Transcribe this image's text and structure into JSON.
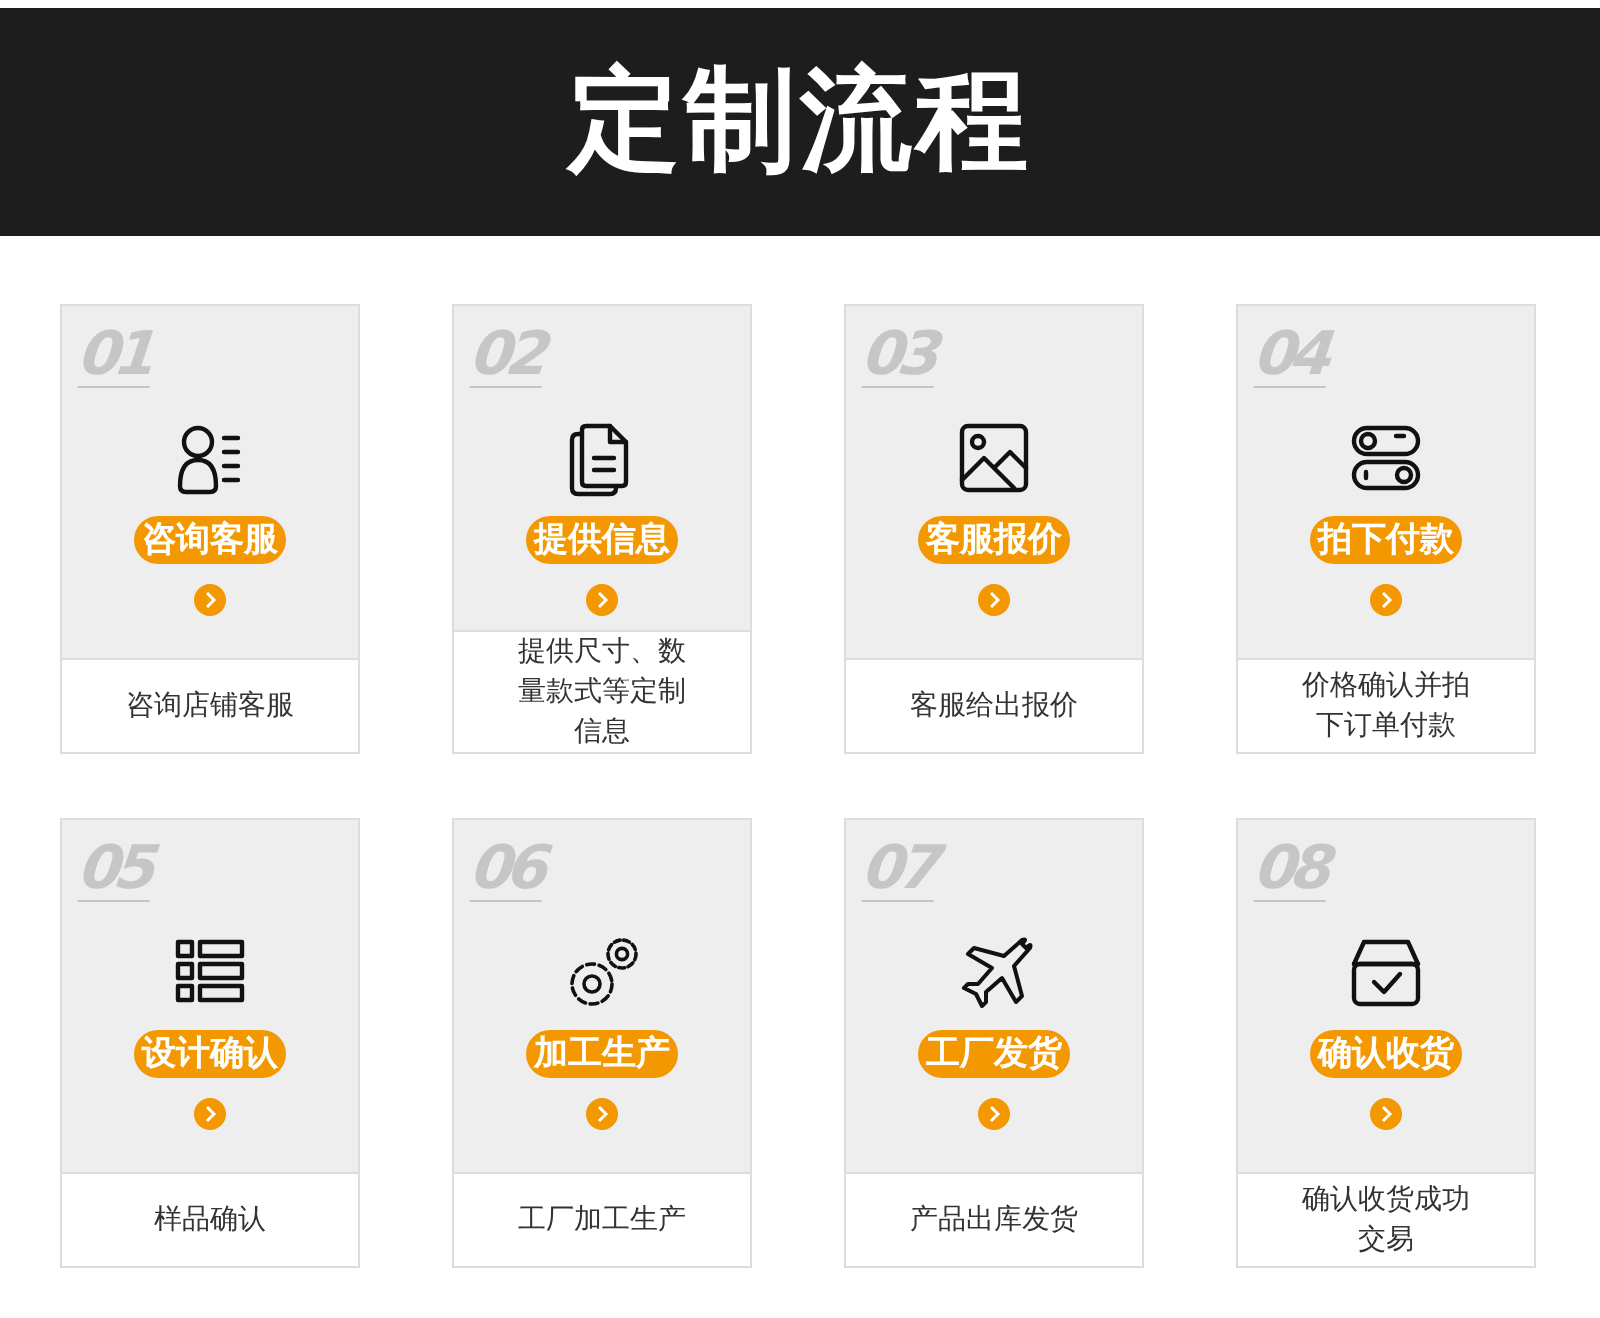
{
  "header": {
    "title": "定制流程"
  },
  "steps": [
    {
      "number": "01",
      "title": "咨询客服",
      "description": "咨询店铺客服"
    },
    {
      "number": "02",
      "title": "提供信息",
      "description": "提供尺寸、数量款式等定制信息"
    },
    {
      "number": "03",
      "title": "客服报价",
      "description": "客服给出报价"
    },
    {
      "number": "04",
      "title": "拍下付款",
      "description": "价格确认并拍下订单付款"
    },
    {
      "number": "05",
      "title": "设计确认",
      "description": "样品确认"
    },
    {
      "number": "06",
      "title": "加工生产",
      "description": "工厂加工生产"
    },
    {
      "number": "07",
      "title": "工厂发货",
      "description": "产品出库发货"
    },
    {
      "number": "08",
      "title": "确认收货",
      "description": "确认收货成功交易"
    }
  ]
}
